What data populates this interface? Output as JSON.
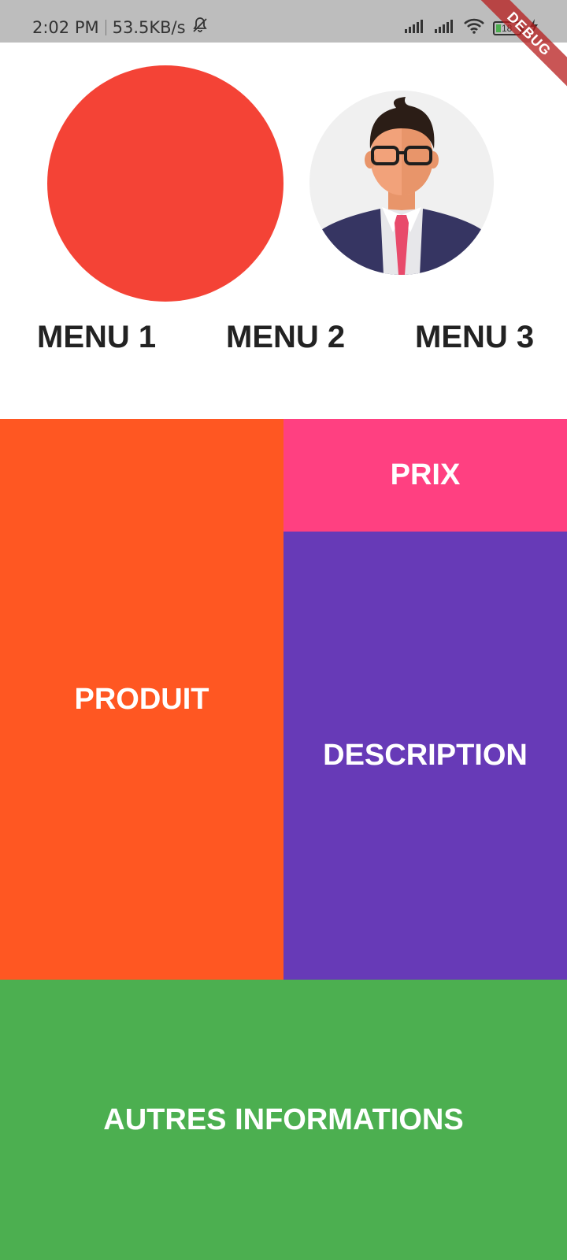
{
  "status_bar": {
    "time": "2:02 PM",
    "speed": "53.5KB/s",
    "battery": "18"
  },
  "debug_banner": "DEBUG",
  "menu": {
    "items": [
      "MENU 1",
      "MENU 2",
      "MENU 3"
    ]
  },
  "blocks": {
    "produit": "PRODUIT",
    "prix": "PRIX",
    "description": "DESCRIPTION",
    "autres": "AUTRES INFORMATIONS"
  },
  "colors": {
    "status_bar": "#bdbdbd",
    "red_circle": "#f44336",
    "produit": "#ff5722",
    "prix": "#ff4081",
    "description": "#673ab7",
    "autres": "#4caf50"
  },
  "icons": {
    "mute": "bell-off-icon",
    "signal": "signal-icon",
    "wifi": "wifi-icon",
    "battery": "battery-icon",
    "charging": "charging-icon"
  }
}
